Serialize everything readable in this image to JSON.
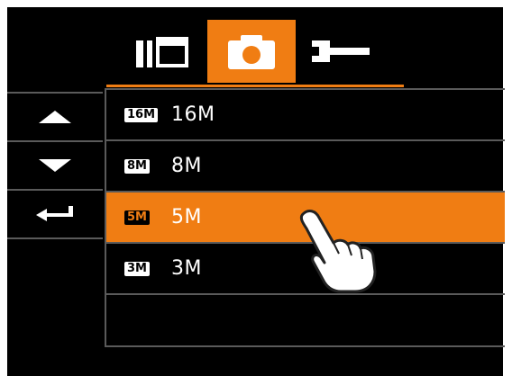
{
  "tabs": [
    {
      "name": "playback",
      "icon": "playback-icon",
      "active": false
    },
    {
      "name": "camera",
      "icon": "camera-icon",
      "active": true
    },
    {
      "name": "setup",
      "icon": "wrench-icon",
      "active": false
    }
  ],
  "nav": {
    "up_icon": "arrow-up-icon",
    "down_icon": "arrow-down-icon",
    "back_icon": "return-icon"
  },
  "resolution_list": {
    "items": [
      {
        "badge": "16M",
        "label": "16M",
        "selected": false
      },
      {
        "badge": "8M",
        "label": "8M",
        "selected": false
      },
      {
        "badge": "5M",
        "label": "5M",
        "selected": true
      },
      {
        "badge": "3M",
        "label": "3M",
        "selected": false
      }
    ]
  },
  "colors": {
    "accent": "#f07d13",
    "background": "#000000",
    "divider": "#5a5a5a",
    "text": "#ffffff"
  },
  "pointer": {
    "icon": "hand-pointer-icon"
  }
}
